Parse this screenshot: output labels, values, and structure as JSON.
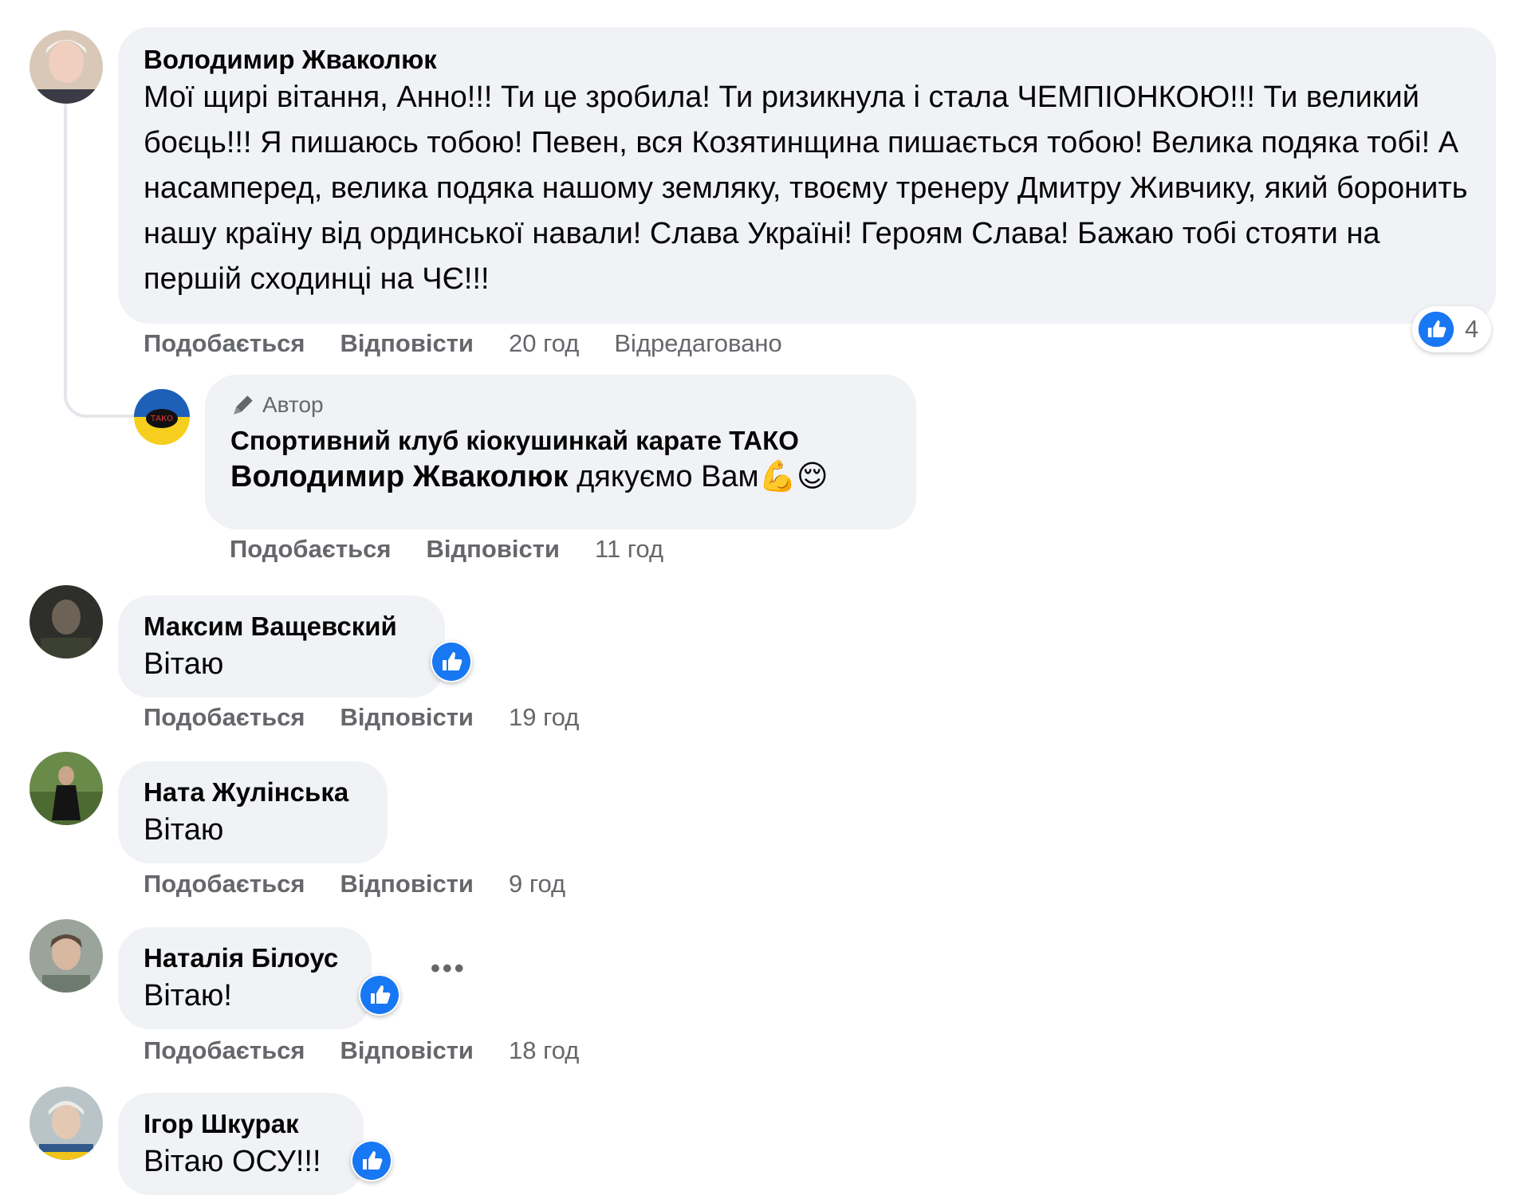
{
  "comments": [
    {
      "author": "Володимир Жваколюк",
      "text": "Мої щирі вітання, Анно!!! Ти це зробила! Ти ризикнула і стала ЧЕМПІОНКОЮ!!! Ти великий боєць!!! Я пишаюсь тобою! Певен, вся Козятинщина пишається тобою! Велика подяка тобі! А насамперед, велика подяка нашому земляку, твоєму тренеру Дмитру Живчику, який боронить нашу країну від ординської навали! Слава Україні! Героям Слава! Бажаю тобі стояти на першій сходинці на ЧЄ!!!",
      "like": "Подобається",
      "reply": "Відповісти",
      "time": "20 год",
      "edited": "Відредаговано",
      "reaction_count": "4"
    },
    {
      "badge": "Автор",
      "author": "Спортивний клуб кіокушинкай карате ТАКО",
      "mention": "Володимир Жваколюк",
      "text": " дякуємо Вам",
      "emojis": "💪😌",
      "like": "Подобається",
      "reply": "Відповісти",
      "time": "11 год"
    },
    {
      "author": "Максим Ващевский",
      "text": "Вітаю",
      "like": "Подобається",
      "reply": "Відповісти",
      "time": "19 год"
    },
    {
      "author": "Ната Жулінська",
      "text": "Вітаю",
      "like": "Подобається",
      "reply": "Відповісти",
      "time": "9 год"
    },
    {
      "author": "Наталія Білоус",
      "text": "Вітаю!",
      "like": "Подобається",
      "reply": "Відповісти",
      "time": "18 год",
      "more": "•••"
    },
    {
      "author": "Ігор Шкурак",
      "text": "Вітаю ОСУ!!!"
    }
  ],
  "colors": {
    "like_blue": "#1877f2",
    "bubble": "#f0f2f5",
    "muted": "#65676b"
  },
  "icons": {
    "reaction": "thumbs-up-icon",
    "badge": "pencil-icon",
    "more": "more-dots-icon"
  }
}
